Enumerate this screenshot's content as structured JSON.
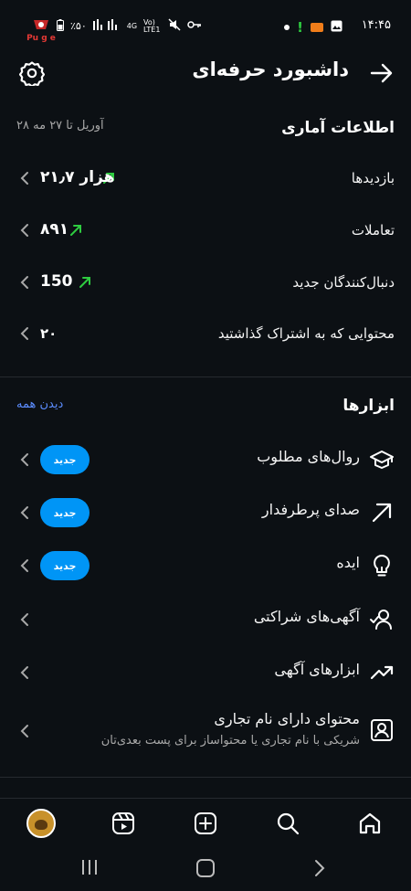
{
  "status_bar": {
    "time": "۱۴:۴۵",
    "battery": "٪۵۰",
    "network": "4G",
    "volte": "Vo) LTE1",
    "logo_text": "Pu g e"
  },
  "header": {
    "title": "داشبورد حرفه‌ای",
    "back_icon": "arrow-right-icon",
    "settings_icon": "gear-icon"
  },
  "stats": {
    "title": "اطلاعات آماری",
    "date_range": "۲۸ آوریل تا ۲۷ مه",
    "rows": [
      {
        "label": "بازدیدها",
        "value": "۲۱٫۷ هزار",
        "trend": "up"
      },
      {
        "label": "تعاملات",
        "value": "۸۹۱",
        "trend": "up"
      },
      {
        "label": "دنبال‌کنندگان جدید",
        "value": "150",
        "trend": "up"
      },
      {
        "label": "محتوایی که به اشتراک گذاشتید",
        "value": "۲۰",
        "trend": "none"
      }
    ]
  },
  "tools": {
    "title": "ابزارها",
    "see_all": "دیدن همه",
    "new_badge": "جدید",
    "items": [
      {
        "label": "روال‌های مطلوب",
        "icon": "graduation-cap-icon",
        "badge": true
      },
      {
        "label": "صدای پرطرفدار",
        "icon": "arrow-up-right-icon",
        "badge": true
      },
      {
        "label": "ایده",
        "icon": "lightbulb-icon",
        "badge": true
      },
      {
        "label": "آگهی‌های شراکتی",
        "icon": "user-check-icon",
        "badge": false
      },
      {
        "label": "ابزارهای آگهی",
        "icon": "trending-up-icon",
        "badge": false
      },
      {
        "label": "محتوای دارای نام تجاری",
        "sub": "شریکی با نام تجاری یا محتواساز برای پست بعدی‌تان",
        "icon": "branded-content-icon",
        "badge": false
      }
    ]
  },
  "bottom_nav": [
    "home-icon",
    "search-icon",
    "create-icon",
    "reels-icon",
    "profile-avatar"
  ],
  "colors": {
    "background": "#0c1014",
    "accent_blue": "#0095f6",
    "link_blue": "#5c8dff",
    "trend_green": "#2ecc40"
  }
}
